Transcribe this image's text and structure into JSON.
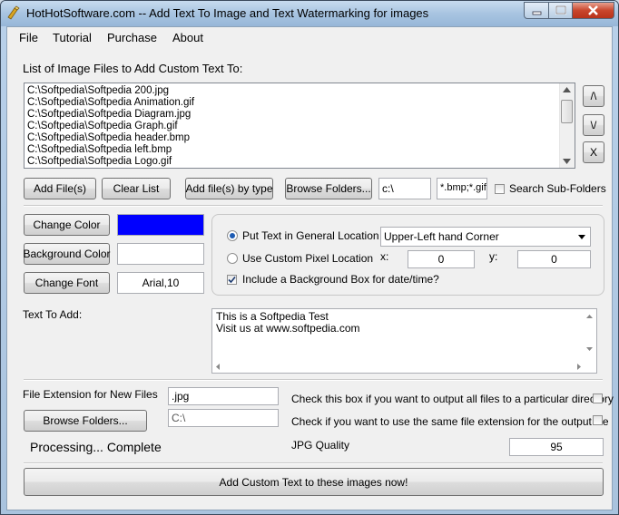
{
  "window": {
    "title": "HotHotSoftware.com -- Add Text To Image and Text Watermarking for images"
  },
  "menu": [
    "File",
    "Tutorial",
    "Purchase",
    "About"
  ],
  "file_list": {
    "label": "List of Image Files to Add Custom Text To:",
    "items": [
      "C:\\Softpedia\\Softpedia 200.jpg",
      "C:\\Softpedia\\Softpedia Animation.gif",
      "C:\\Softpedia\\Softpedia Diagram.jpg",
      "C:\\Softpedia\\Softpedia Graph.gif",
      "C:\\Softpedia\\Softpedia header.bmp",
      "C:\\Softpedia\\Softpedia left.bmp",
      "C:\\Softpedia\\Softpedia Logo.gif"
    ],
    "move_up": "/\\",
    "move_down": "\\/",
    "remove": "X"
  },
  "buttons": {
    "add_files": "Add File(s)",
    "clear_list": "Clear List",
    "add_by_type": "Add file(s) by type",
    "browse_folders": "Browse Folders...",
    "change_color": "Change Color",
    "background_color": "Background Color",
    "change_font": "Change Font",
    "browse_output": "Browse Folders...",
    "run": "Add Custom Text to these images now!"
  },
  "browse": {
    "path": "c:\\",
    "types": "*.bmp;*.gif;",
    "search_sub": "Search Sub-Folders",
    "search_sub_checked": false
  },
  "colors": {
    "text_color": "#0000ff",
    "background_color": "#ffffff"
  },
  "font_value": "Arial,10",
  "location": {
    "general_label": "Put Text in General Location",
    "general_selected": true,
    "general_value": "Upper-Left hand Corner",
    "custom_label": "Use Custom Pixel Location",
    "x_label": "x:",
    "x_value": "0",
    "y_label": "y:",
    "y_value": "0",
    "bg_box_label": "Include a Background Box for date/time?",
    "bg_box_checked": true
  },
  "text_to_add": {
    "label": "Text To Add:",
    "line1": "This is a Softpedia Test",
    "line2": "Visit us at www.softpedia.com"
  },
  "output": {
    "ext_label": "File Extension for New Files",
    "ext_value": ".jpg",
    "dir_value": "C:\\",
    "dir_check_label": "Check this box if you want to output all files to a particular directory",
    "same_ext_label": "Check if you want to use the same file extension for the output file",
    "jpg_quality_label": "JPG Quality",
    "jpg_quality_value": "95",
    "status": "Processing... Complete"
  }
}
